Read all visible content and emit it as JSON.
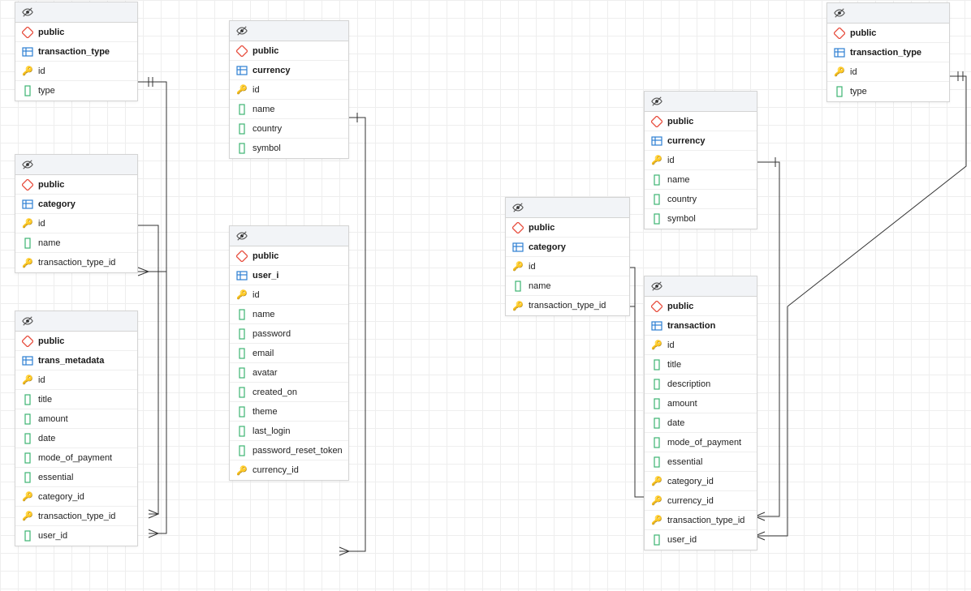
{
  "schema_label": "public",
  "tables": {
    "transaction_type_a": {
      "name": "transaction_type",
      "columns": [
        "id",
        "type"
      ]
    },
    "category_a": {
      "name": "category",
      "columns": [
        "id",
        "name",
        "transaction_type_id"
      ]
    },
    "trans_metadata": {
      "name": "trans_metadata",
      "columns": [
        "id",
        "title",
        "amount",
        "date",
        "mode_of_payment",
        "essential",
        "category_id",
        "transaction_type_id",
        "user_id"
      ]
    },
    "currency_a": {
      "name": "currency",
      "columns": [
        "id",
        "name",
        "country",
        "symbol"
      ]
    },
    "user_i": {
      "name": "user_i",
      "columns": [
        "id",
        "name",
        "password",
        "email",
        "avatar",
        "created_on",
        "theme",
        "last_login",
        "password_reset_token",
        "currency_id"
      ]
    },
    "category_b": {
      "name": "category",
      "columns": [
        "id",
        "name",
        "transaction_type_id"
      ]
    },
    "currency_b": {
      "name": "currency",
      "columns": [
        "id",
        "name",
        "country",
        "symbol"
      ]
    },
    "transaction_type_b": {
      "name": "transaction_type",
      "columns": [
        "id",
        "type"
      ]
    },
    "transaction": {
      "name": "transaction",
      "columns": [
        "id",
        "title",
        "description",
        "amount",
        "date",
        "mode_of_payment",
        "essential",
        "category_id",
        "currency_id",
        "transaction_type_id",
        "user_id"
      ]
    }
  },
  "column_types": {
    "id": "pk",
    "transaction_type_id": "fk",
    "category_id": "fk",
    "currency_id": "fk",
    "user_id": "col"
  }
}
